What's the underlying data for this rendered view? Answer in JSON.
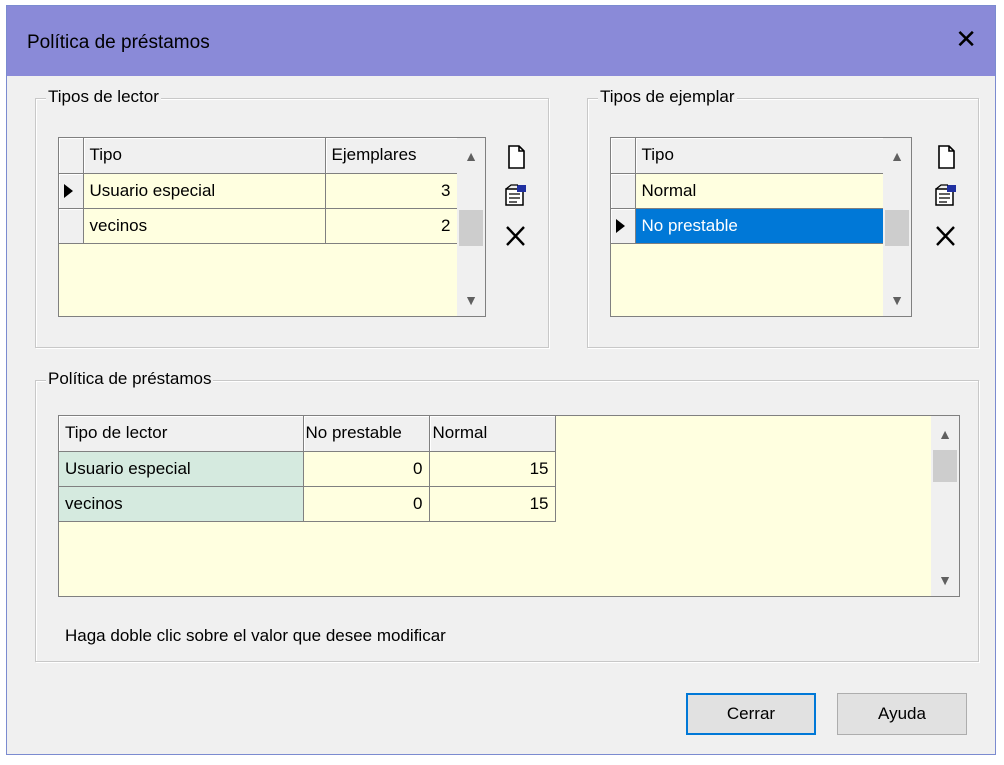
{
  "window": {
    "title": "Política de préstamos"
  },
  "reader_types": {
    "legend": "Tipos de lector",
    "columns": [
      "Tipo",
      "Ejemplares"
    ],
    "rows": [
      {
        "tipo": "Usuario especial",
        "ejemplares": "3"
      },
      {
        "tipo": "vecinos",
        "ejemplares": "2"
      }
    ]
  },
  "copy_types": {
    "legend": "Tipos de ejemplar",
    "columns": [
      "Tipo"
    ],
    "rows": [
      {
        "tipo": "Normal"
      },
      {
        "tipo": "No prestable"
      }
    ]
  },
  "policy": {
    "legend": "Política de préstamos",
    "columns": [
      "Tipo de lector",
      "No prestable",
      "Normal"
    ],
    "rows": [
      {
        "lector": "Usuario especial",
        "no_prestable": "0",
        "normal": "15"
      },
      {
        "lector": "vecinos",
        "no_prestable": "0",
        "normal": "15"
      }
    ],
    "hint": "Haga doble clic sobre el valor que desee modificar"
  },
  "buttons": {
    "close": "Cerrar",
    "help": "Ayuda"
  },
  "colors": {
    "titlebar": "#8a8ad8",
    "grid_bg": "#ffffe0",
    "selection": "#0078d7",
    "row_header": "#d5eadf"
  }
}
